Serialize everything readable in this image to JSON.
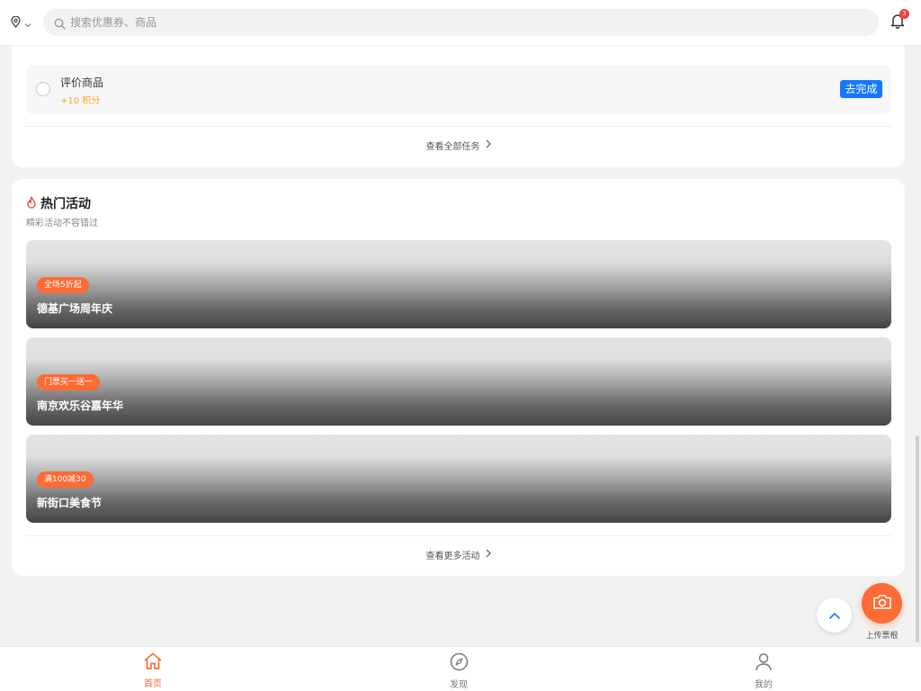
{
  "search": {
    "placeholder": "搜索优惠券、商品"
  },
  "notifications": {
    "count": "3"
  },
  "tasks": {
    "items": [
      {
        "name": "评价商品",
        "points": "+10 积分",
        "action": "去完成"
      }
    ],
    "view_all": "查看全部任务"
  },
  "hot": {
    "title": "热门活动",
    "subtitle": "精彩活动不容错过",
    "banners": [
      {
        "tag": "全场5折起",
        "name": "德基广场周年庆"
      },
      {
        "tag": "门票买一送一",
        "name": "南京欢乐谷嘉年华"
      },
      {
        "tag": "满100减30",
        "name": "新街口美食节"
      }
    ],
    "view_more": "查看更多活动"
  },
  "upload": {
    "label": "上传票根"
  },
  "tabbar": {
    "tabs": [
      {
        "label": "首页",
        "icon": "home-icon",
        "active": true
      },
      {
        "label": "发现",
        "icon": "compass-icon",
        "active": false
      },
      {
        "label": "我的",
        "icon": "user-icon",
        "active": false
      }
    ]
  },
  "colors": {
    "accent": "#ff6b35",
    "primary_button": "#1677ff",
    "points": "#f5a623",
    "badge": "#f2403b"
  }
}
